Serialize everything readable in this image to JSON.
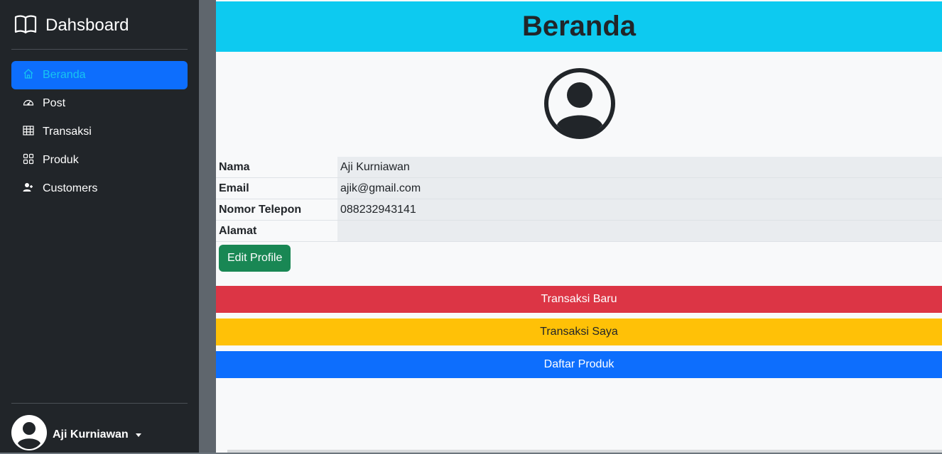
{
  "brand": {
    "title": "Dahsboard",
    "icon": "book-icon"
  },
  "sidebar": {
    "items": [
      {
        "label": "Beranda",
        "icon": "home-icon",
        "active": true
      },
      {
        "label": "Post",
        "icon": "speedometer-icon",
        "active": false
      },
      {
        "label": "Transaksi",
        "icon": "table-icon",
        "active": false
      },
      {
        "label": "Produk",
        "icon": "grid-icon",
        "active": false
      },
      {
        "label": "Customers",
        "icon": "people-icon",
        "active": false
      }
    ]
  },
  "user": {
    "name": "Aji Kurniawan",
    "icon": "person-circle-icon"
  },
  "header": {
    "title": "Beranda"
  },
  "profile": {
    "avatar_icon": "person-circle-icon",
    "rows": [
      {
        "key": "Nama",
        "value": "Aji Kurniawan"
      },
      {
        "key": "Email",
        "value": "ajik@gmail.com"
      },
      {
        "key": "Nomor Telepon",
        "value": "088232943141"
      },
      {
        "key": "Alamat",
        "value": ""
      }
    ],
    "edit_label": "Edit Profile"
  },
  "actions": {
    "new_transaction": "Transaksi Baru",
    "my_transactions": "Transaksi Saya",
    "product_list": "Daftar Produk"
  },
  "colors": {
    "sidebar_bg": "#212529",
    "active": "#0d6efd",
    "header": "#0dcaf0",
    "success": "#198754",
    "danger": "#dc3545",
    "warning": "#ffc107",
    "primary": "#0d6efd"
  }
}
